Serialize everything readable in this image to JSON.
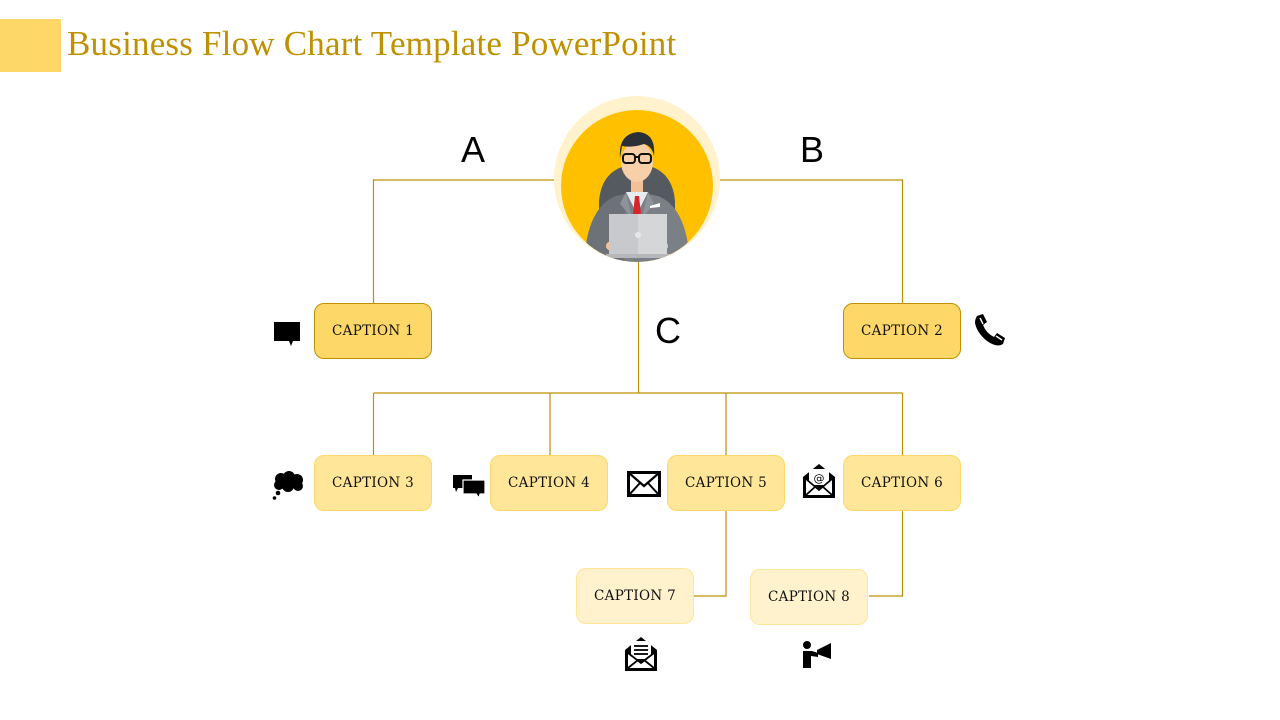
{
  "title": "Business Flow Chart Template PowerPoint",
  "colors": {
    "accent": "#FDD868",
    "title": "#BF9000",
    "connector": "#BF9000",
    "avatar_bg": "#FFC000",
    "avatar_halo": "#FFF2CC"
  },
  "center": {
    "icon": "businessman-with-laptop-icon"
  },
  "branch_labels": {
    "a": "A",
    "b": "B",
    "c": "C"
  },
  "captions": [
    {
      "label": "CAPTION 1",
      "icon": "speech-bubble-icon"
    },
    {
      "label": "CAPTION 2",
      "icon": "phone-icon"
    },
    {
      "label": "CAPTION 3",
      "icon": "thought-cloud-icon"
    },
    {
      "label": "CAPTION 4",
      "icon": "chat-bubbles-icon"
    },
    {
      "label": "CAPTION 5",
      "icon": "envelope-icon"
    },
    {
      "label": "CAPTION 6",
      "icon": "email-at-icon"
    },
    {
      "label": "CAPTION 7",
      "icon": "open-letter-icon"
    },
    {
      "label": "CAPTION 8",
      "icon": "megaphone-person-icon"
    }
  ]
}
